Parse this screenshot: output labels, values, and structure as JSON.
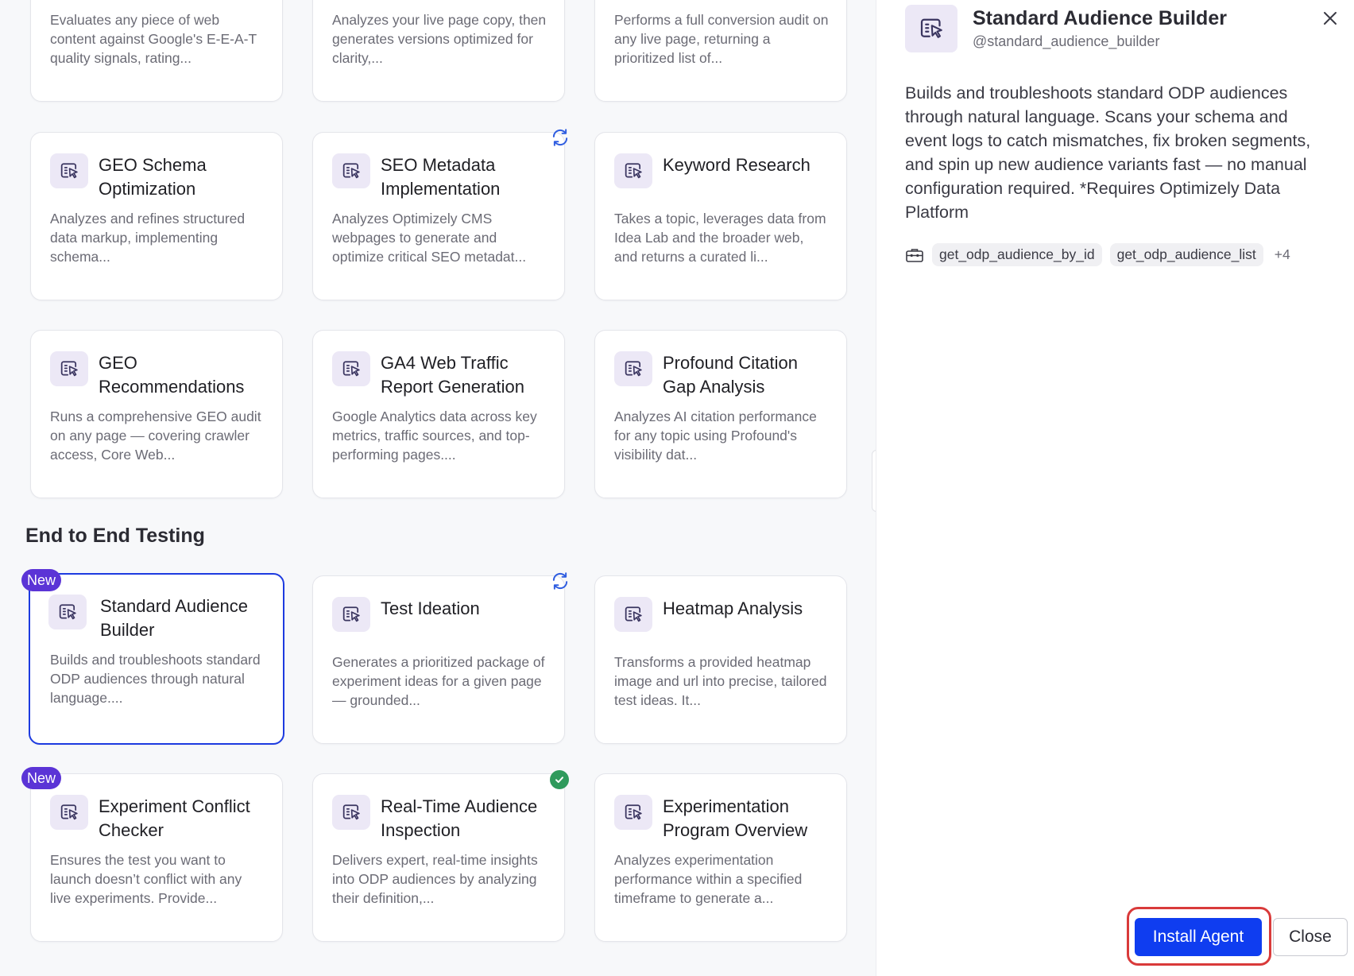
{
  "cards_top_partial": [
    {
      "description": "Evaluates any piece of web content against Google's E-E-A-T quality signals, rating..."
    },
    {
      "description": "Analyzes your live page copy, then generates versions optimized for clarity,..."
    },
    {
      "description": "Performs a full conversion audit on any live page, returning a prioritized list of..."
    }
  ],
  "cards_row2": [
    {
      "title": "GEO Schema Optimization",
      "description": "Analyzes and refines structured data markup, implementing schema..."
    },
    {
      "title": "SEO Metadata Implementation",
      "description": "Analyzes Optimizely CMS webpages to generate and optimize critical SEO metadat..."
    },
    {
      "title": "Keyword Research",
      "description": "Takes a topic, leverages data from Idea Lab and the broader web, and returns a curated li..."
    }
  ],
  "cards_row3": [
    {
      "title": "GEO Recommendations",
      "description": "Runs a comprehensive GEO audit on any page — covering crawler access, Core Web..."
    },
    {
      "title": "GA4 Web Traffic Report Generation",
      "description": "Google Analytics data across key metrics, traffic sources, and top-performing pages...."
    },
    {
      "title": "Profound Citation Gap Analysis",
      "description": "Analyzes AI citation performance for any topic using Profound's visibility dat..."
    }
  ],
  "section": {
    "title": "End to End Testing"
  },
  "badge": {
    "new_label": "New"
  },
  "cards_row4": [
    {
      "title": "Standard Audience Builder",
      "description": "Builds and troubleshoots standard ODP audiences through natural language...."
    },
    {
      "title": "Test Ideation",
      "description": "Generates a prioritized package of experiment ideas for a given page — grounded..."
    },
    {
      "title": "Heatmap Analysis",
      "description": "Transforms a provided heatmap image and url into precise, tailored test ideas. It..."
    }
  ],
  "cards_row5": [
    {
      "title": "Experiment Conflict Checker",
      "description": "Ensures the test you want to launch doesn’t conflict with any live experiments. Provide..."
    },
    {
      "title": "Real-Time Audience Inspection",
      "description": "Delivers expert, real-time insights into ODP audiences by analyzing their definition,..."
    },
    {
      "title": "Experimentation Program Overview",
      "description": "Analyzes experimentation performance within a specified timeframe to generate a..."
    }
  ],
  "panel": {
    "title": "Standard Audience Builder",
    "handle": "@standard_audience_builder",
    "description": "Builds and troubleshoots standard ODP audiences through natural language. Scans your schema and event logs to catch mismatches, fix broken segments, and spin up new audience variants fast — no manual configuration required. *Requires Optimizely Data Platform",
    "tools": [
      "get_odp_audience_by_id",
      "get_odp_audience_list"
    ],
    "tools_more": "+4",
    "install_label": "Install Agent",
    "close_label": "Close"
  },
  "colors": {
    "accent": "#0f3df0",
    "selected_border": "#1d3be0",
    "badge_new": "#5b34d6",
    "highlight": "#d93a3a",
    "success": "#2f9a5c",
    "icon_bg": "#ece8f6"
  },
  "icons": {
    "agent": "agent-cursor-icon",
    "sync": "sync-icon",
    "check": "check-circle-icon",
    "tools": "toolbox-icon",
    "close": "close-icon"
  }
}
